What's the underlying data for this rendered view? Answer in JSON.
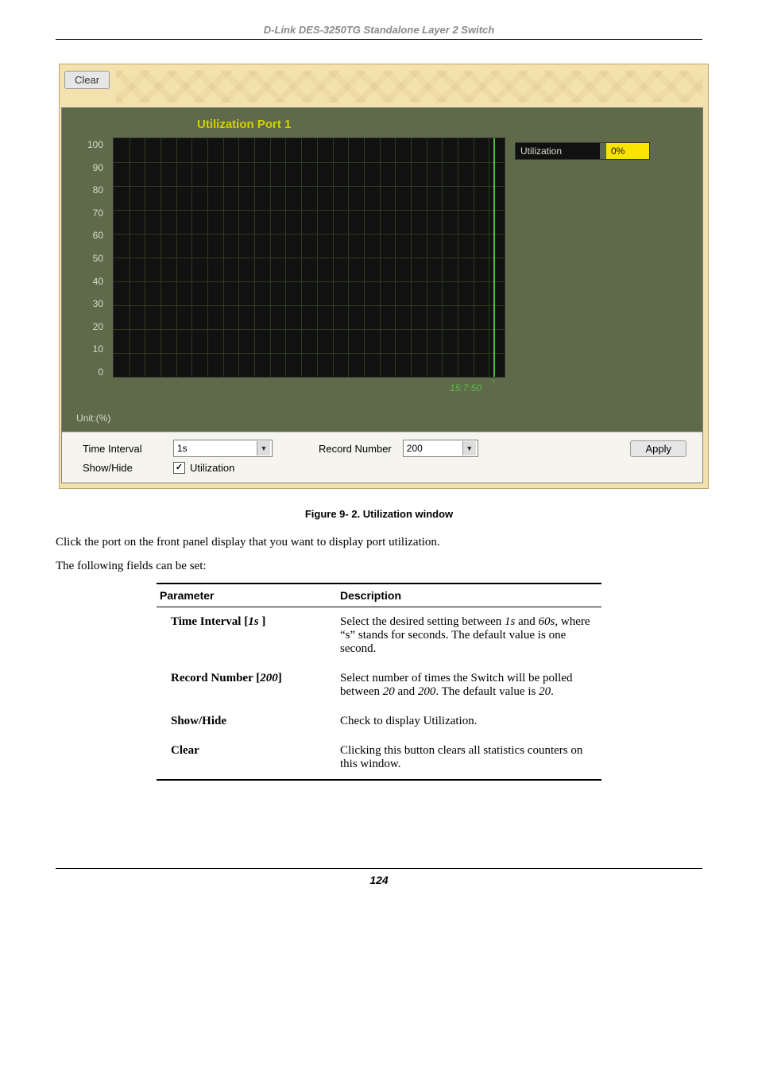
{
  "header": {
    "title": "D-Link DES-3250TG Standalone Layer 2 Switch"
  },
  "screenshot": {
    "clear_label": "Clear",
    "chart_title": "Utilization  Port 1",
    "y_ticks": [
      "100",
      "90",
      "80",
      "70",
      "60",
      "50",
      "40",
      "30",
      "20",
      "10",
      "0"
    ],
    "legend": {
      "label": "Utilization",
      "value": "0%"
    },
    "timestamp": "15:7:50",
    "unit_label": "Unit:(%)",
    "controls": {
      "time_interval_label": "Time Interval",
      "time_interval_value": "1s",
      "record_number_label": "Record Number",
      "record_number_value": "200",
      "apply_label": "Apply",
      "showhide_label": "Show/Hide",
      "util_checkbox_label": "Utilization",
      "util_checked": true
    }
  },
  "chart_data": {
    "type": "line",
    "title": "Utilization Port 1",
    "xlabel": "",
    "ylabel": "Utilization (%)",
    "ylim": [
      0,
      100
    ],
    "y_ticks": [
      0,
      10,
      20,
      30,
      40,
      50,
      60,
      70,
      80,
      90,
      100
    ],
    "series": [
      {
        "name": "Utilization",
        "values": [
          0
        ],
        "current": "0%"
      }
    ],
    "timestamp": "15:7:50",
    "record_number": 200,
    "time_interval_s": 1
  },
  "figure_caption": "Figure 9- 2.  Utilization window",
  "body": {
    "p1": "Click the port on the front panel display that you want to display port utilization.",
    "p2": "The following fields can be set:"
  },
  "table": {
    "headers": {
      "param": "Parameter",
      "desc": "Description"
    },
    "rows": [
      {
        "name_prefix": "Time Interval [",
        "name_ital": "1s",
        "name_suffix": " ]",
        "desc_a": "Select the desired setting between ",
        "desc_i1": "1s",
        "desc_mid": " and ",
        "desc_i2": "60s",
        "desc_b": ", where “s” stands for seconds. The default value is one second."
      },
      {
        "name_prefix": "Record Number [",
        "name_ital": "200",
        "name_suffix": "]",
        "desc_a": "Select number of times the Switch will be polled between ",
        "desc_i1": "20",
        "desc_mid": " and ",
        "desc_i2": "200",
        "desc_b": ". The default value is ",
        "desc_i3": "20",
        "desc_c": "."
      },
      {
        "name_plain": "Show/Hide",
        "desc_plain": "Check to display Utilization."
      },
      {
        "name_plain": "Clear",
        "desc_plain": "Clicking this button clears all statistics counters on this window."
      }
    ]
  },
  "footer": {
    "page": "124"
  }
}
